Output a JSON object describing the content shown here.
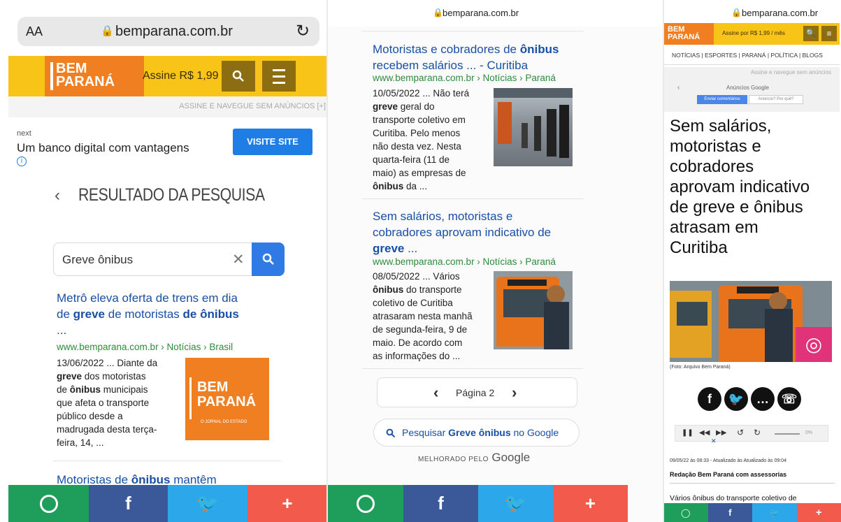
{
  "colors": {
    "accent_yellow": "#f7c417",
    "brand_orange": "#f07f22",
    "link_blue": "#1a4fa6",
    "url_green": "#2d8b3c",
    "whatsapp": "#1f9d5a",
    "facebook": "#3b5998",
    "twitter": "#2ba7ea",
    "plus": "#f25b4b"
  },
  "panel1": {
    "text_size": "AA",
    "domain": "bemparana.com.br",
    "brand_line1": "BEM",
    "brand_line2": "PARANÁ",
    "subscribe": "Assine R$ 1,99",
    "ad_free": "ASSINE E NAVEGUE SEM ANÚNCIOS [+]",
    "ad_sponsor": "next",
    "ad_text": "Um banco digital com vantagens",
    "ad_button": "VISITE SITE",
    "page_heading": "RESULTADO DA PESQUISA",
    "search_value": "Greve ônibus",
    "result1": {
      "t1": "Metrô eleva oferta de trens em dia",
      "t2": "de ",
      "t3": "greve",
      "t4": " de motoristas ",
      "t5": "de ônibus",
      "t6": "...",
      "url": "www.bemparana.com.br › Notícias › Brasil",
      "s_date": "13/06/2022 ...",
      "s1": " Diante da",
      "s2": "greve",
      "s3": " dos motoristas",
      "s4": "de ",
      "s5": "ônibus",
      "s6": " municipais",
      "s7": "que afeta o transporte",
      "s8": "público desde a",
      "s9": "madrugada desta terça-",
      "s10": "feira, 14, ...",
      "thumb_l1": "BEM",
      "thumb_l2": "PARANÁ",
      "thumb_tag": "O JORNAL DO ESTADO"
    },
    "result2_part1": "Motoristas de ",
    "result2_part2": "ônibus",
    "result2_part3": " mantêm"
  },
  "panel2": {
    "domain": "bemparana.com.br",
    "r1": {
      "t1": "Motoristas e cobradores de ",
      "t2": "ônibus",
      "t3": "recebem salários ... - Curitiba",
      "url": "www.bemparana.com.br › Notícias › Paraná",
      "l1a": "10/05/2022 ...",
      "l1b": " Não terá",
      "l2a": "greve",
      "l2b": " geral do",
      "l3": "transporte coletivo em",
      "l4": "Curitiba. Pelo menos",
      "l5": "não desta vez. Nesta",
      "l6": "quarta-feira (11 de",
      "l7": "maio) as empresas de",
      "l8a": "ônibus",
      "l8b": " da ..."
    },
    "r2": {
      "t1": "Sem salários, motoristas e",
      "t2": "cobradores aprovam indicativo de",
      "t3": "greve",
      "t4": " ...",
      "url": "www.bemparana.com.br › Notícias › Paraná",
      "l1a": "08/05/2022 ...",
      "l1b": " Vários",
      "l2a": "ônibus",
      "l2b": " do transporte",
      "l3": "coletivo de Curitiba",
      "l4": "atrasaram nesta manhã",
      "l5": "de segunda-feira, 9 de",
      "l6": "maio. De acordo com",
      "l7": "as informações do ..."
    },
    "page_label": "Página 2",
    "google_search_pre": "Pesquisar ",
    "google_search_bold": "Greve ônibus",
    "google_search_post": " no Google",
    "enhanced": "MELHORADO PELO",
    "google": "Google"
  },
  "panel3": {
    "domain": "bemparana.com.br",
    "brand_line1": "BEM",
    "brand_line2": "PARANÁ",
    "subscribe": "Assine por R$ 1,99 / mês",
    "nav": "NOTÍCIAS | ESPORTES | PARANÁ | POLÍTICA | BLOGS",
    "ad_free": "Assine e navegue sem anúncios",
    "ads_by": "Anúncios Google",
    "ad_feedback": "Enviar comentários",
    "ad_why": "Anúncio? Por quê?",
    "headline": [
      "Sem salários,",
      "motoristas e",
      "cobradores",
      "aprovam indicativo",
      "de greve e ônibus",
      "atrasam em",
      "Curitiba"
    ],
    "photo_caption": "(Foto: Arquivo Bem Paraná)",
    "audio_pct": "0%",
    "meta": "09/05/22 às 08:33 - Atualizado às Atualizado às 09:04",
    "author": "Redação Bem Paraná com assessorias",
    "lede": "Vários ônibus do transporte coletivo de"
  }
}
